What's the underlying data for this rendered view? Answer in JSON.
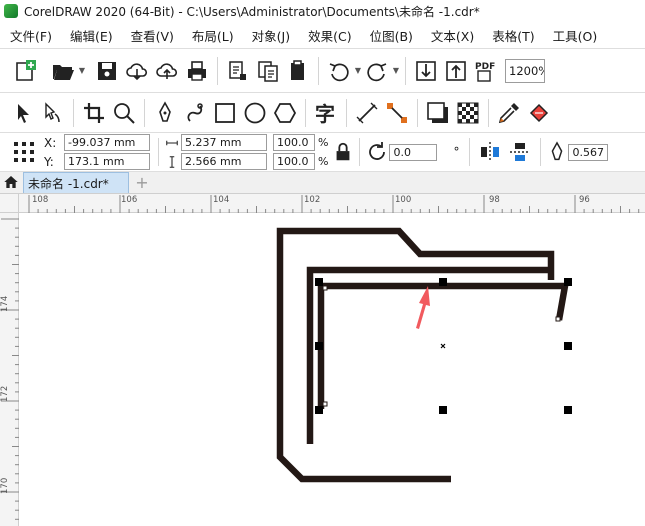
{
  "window": {
    "title": "CorelDRAW 2020 (64-Bit) - C:\\Users\\Administrator\\Documents\\未命名 -1.cdr*"
  },
  "menu": [
    "文件(F)",
    "编辑(E)",
    "查看(V)",
    "布局(L)",
    "对象(J)",
    "效果(C)",
    "位图(B)",
    "文本(X)",
    "表格(T)",
    "工具(O)"
  ],
  "toolbar": {
    "zoom": "1200%"
  },
  "properties": {
    "x_label": "X:",
    "x_value": "-99.037 mm",
    "y_label": "Y:",
    "y_value": "173.1 mm",
    "width_value": "5.237 mm",
    "height_value": "2.566 mm",
    "scale_x": "100.0",
    "scale_y": "100.0",
    "pct_symbol": "%",
    "rotation": "0.0",
    "degree_symbol": "°",
    "outline_width": "0.567"
  },
  "tabs": {
    "document": "未命名 -1.cdr*",
    "add": "+"
  },
  "rulers": {
    "horizontal": [
      "108",
      "106",
      "104",
      "102",
      "100",
      "98",
      "96"
    ],
    "vertical": [
      "174",
      "172",
      "170"
    ]
  },
  "colors": {
    "shape_stroke": "#231815",
    "arrow": "#f15a5e",
    "handle": "#000000",
    "tab_active": "#cfe3f6"
  },
  "icons": {
    "selection_handle": "square-handle",
    "center_marker": "x-mark"
  }
}
